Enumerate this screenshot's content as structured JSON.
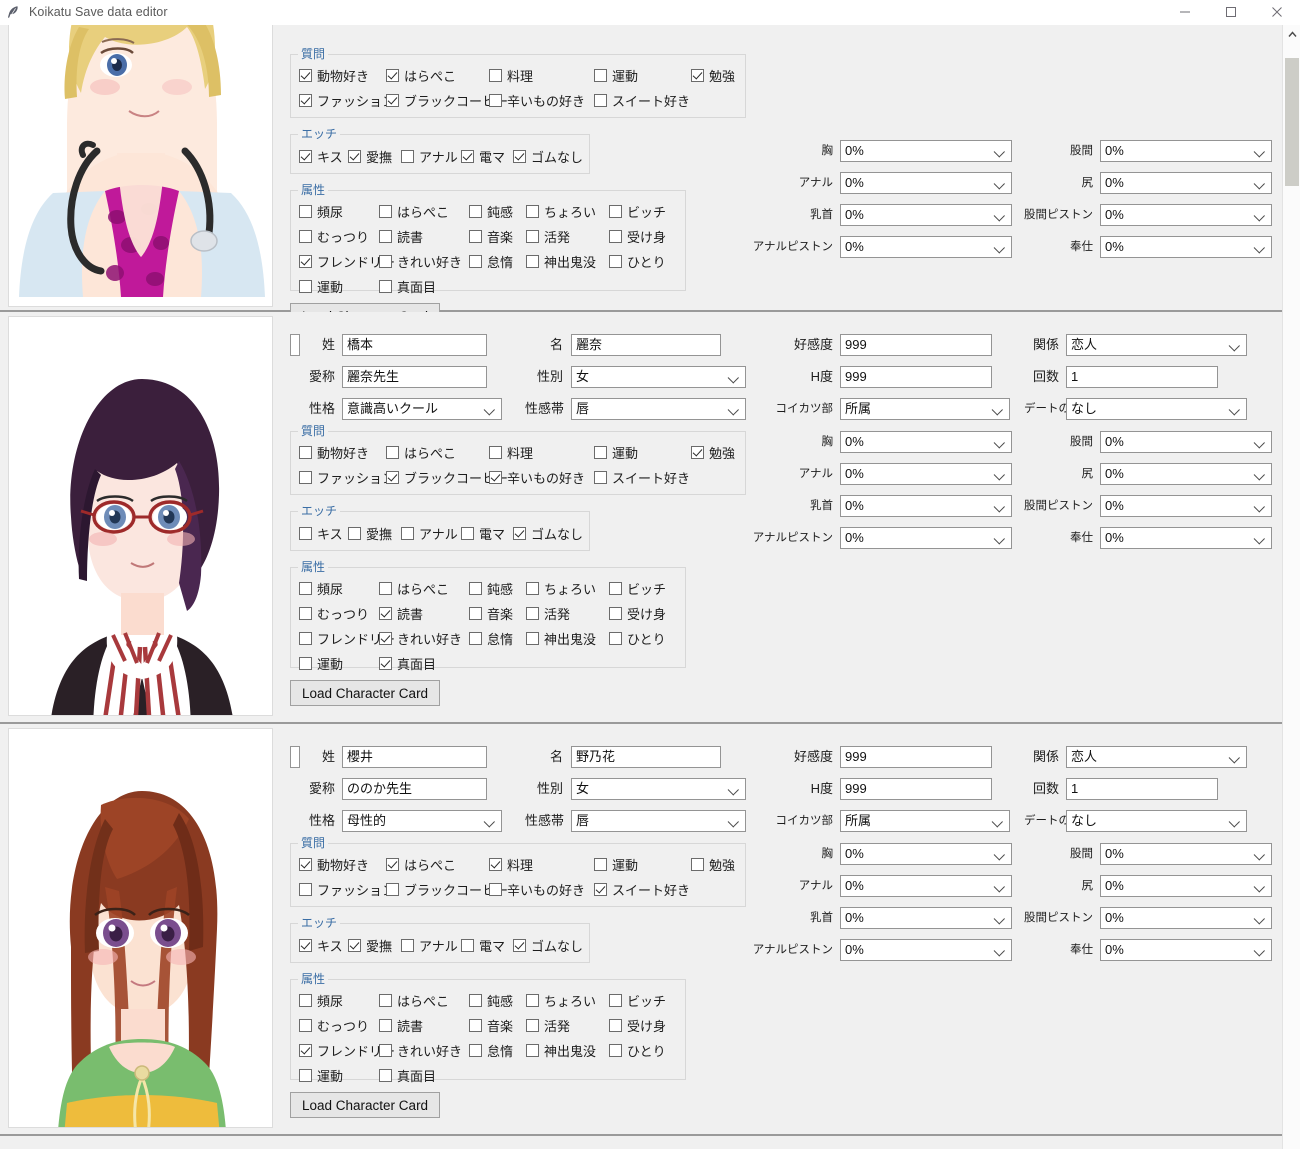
{
  "window": {
    "title": "Koikatu Save data editor",
    "icon": "feather-icon",
    "minimize_label": "–",
    "maximize_label": "□",
    "close_label": "✕"
  },
  "labels": {
    "surname": "姓",
    "given_name": "名",
    "nickname": "愛称",
    "gender": "性別",
    "personality": "性格",
    "erogenous_zone": "性感帯",
    "affection": "好感度",
    "relation": "関係",
    "h_level": "H度",
    "count": "回数",
    "club": "コイカツ部",
    "date_promise": "デートの約束",
    "breast": "胸",
    "crotch": "股間",
    "anal": "アナル",
    "butt": "尻",
    "nipple": "乳首",
    "crotch_piston": "股間ピストン",
    "anal_piston": "アナルピストン",
    "service": "奉仕",
    "group_question": "質問",
    "group_ecchi": "エッチ",
    "group_attribute": "属性",
    "load_card": "Load Character Card"
  },
  "question_items": [
    "動物好き",
    "はらぺこ",
    "料理",
    "運動",
    "勉強",
    "ファッション",
    "ブラックコーヒー",
    "辛いもの好き",
    "スイート好き"
  ],
  "ecchi_items": [
    "キス",
    "愛撫",
    "アナル",
    "電マ",
    "ゴムなし"
  ],
  "attribute_items": [
    "頻尿",
    "はらぺこ",
    "鈍感",
    "ちょろい",
    "ビッチ",
    "むっつり",
    "読書",
    "音楽",
    "活発",
    "受け身",
    "フレンドリー",
    "きれい好き",
    "怠惰",
    "神出鬼没",
    "ひとり",
    "運動",
    "真面目"
  ],
  "characters": [
    {
      "id": "character-1",
      "partial": true,
      "portrait": "blonde-doctor-portrait",
      "surname": "",
      "given_name": "",
      "nickname": "",
      "gender": "",
      "personality": "",
      "erogenous_zone": "",
      "affection": "",
      "relation": "",
      "h_level": "",
      "count": "",
      "club": "",
      "date_promise": "",
      "stats": {
        "breast": "0%",
        "crotch": "0%",
        "anal": "0%",
        "butt": "0%",
        "nipple": "0%",
        "crotch_piston": "0%",
        "anal_piston": "0%",
        "service": "0%"
      },
      "question": [
        true,
        true,
        false,
        false,
        true,
        true,
        true,
        false,
        false
      ],
      "ecchi": [
        true,
        true,
        false,
        true,
        true
      ],
      "attribute": [
        false,
        false,
        false,
        false,
        false,
        false,
        false,
        false,
        false,
        false,
        true,
        false,
        false,
        false,
        false,
        false,
        false
      ]
    },
    {
      "id": "character-2",
      "partial": false,
      "portrait": "glasses-suit-portrait",
      "surname": "橋本",
      "given_name": "麗奈",
      "nickname": "麗奈先生",
      "gender": "女",
      "personality": "意識高いクール",
      "erogenous_zone": "唇",
      "affection": "999",
      "relation": "恋人",
      "h_level": "999",
      "count": "1",
      "club": "所属",
      "date_promise": "なし",
      "stats": {
        "breast": "0%",
        "crotch": "0%",
        "anal": "0%",
        "butt": "0%",
        "nipple": "0%",
        "crotch_piston": "0%",
        "anal_piston": "0%",
        "service": "0%"
      },
      "question": [
        false,
        false,
        false,
        false,
        true,
        false,
        true,
        true,
        false
      ],
      "ecchi": [
        false,
        false,
        false,
        false,
        true
      ],
      "attribute": [
        false,
        false,
        false,
        false,
        false,
        false,
        true,
        false,
        false,
        false,
        false,
        true,
        false,
        false,
        false,
        false,
        true
      ]
    },
    {
      "id": "character-3",
      "partial": false,
      "portrait": "brown-hair-portrait",
      "surname": "櫻井",
      "given_name": "野乃花",
      "nickname": "ののか先生",
      "gender": "女",
      "personality": "母性的",
      "erogenous_zone": "唇",
      "affection": "999",
      "relation": "恋人",
      "h_level": "999",
      "count": "1",
      "club": "所属",
      "date_promise": "なし",
      "stats": {
        "breast": "0%",
        "crotch": "0%",
        "anal": "0%",
        "butt": "0%",
        "nipple": "0%",
        "crotch_piston": "0%",
        "anal_piston": "0%",
        "service": "0%"
      },
      "question": [
        true,
        true,
        true,
        false,
        false,
        false,
        false,
        false,
        true
      ],
      "ecchi": [
        true,
        true,
        false,
        false,
        true
      ],
      "attribute": [
        false,
        false,
        false,
        false,
        false,
        false,
        false,
        false,
        false,
        false,
        true,
        false,
        false,
        false,
        false,
        false,
        false
      ]
    }
  ],
  "scrollbar": {
    "up_arrow": "⌃"
  },
  "colors": {
    "group_title": "#3b6ea5",
    "window_bg": "#f0f0f0",
    "field_border": "#949494"
  }
}
